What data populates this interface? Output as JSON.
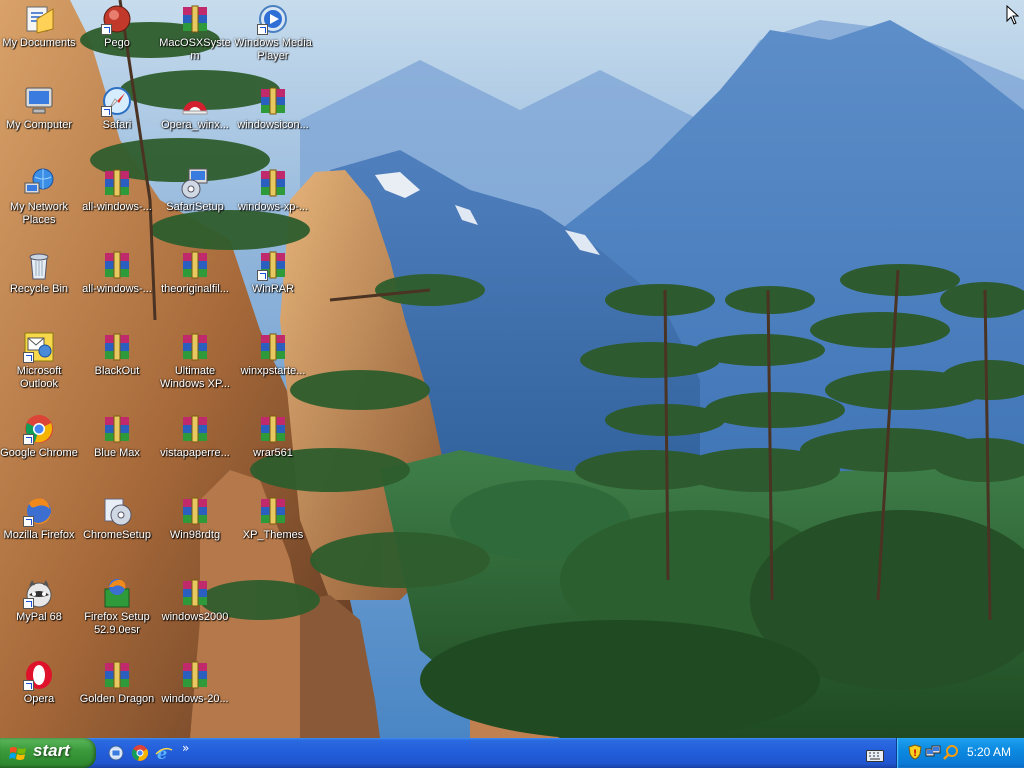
{
  "desktop": {
    "icons": [
      {
        "label": "My Documents"
      },
      {
        "label": "Pego"
      },
      {
        "label": "MacOSXSystem"
      },
      {
        "label": "Windows Media Player"
      },
      {
        "label": "My Computer"
      },
      {
        "label": "Safari"
      },
      {
        "label": "Opera_winx..."
      },
      {
        "label": "windowsicon..."
      },
      {
        "label": "My Network Places"
      },
      {
        "label": "all-windows-..."
      },
      {
        "label": "SafariSetup"
      },
      {
        "label": "windows-xp-..."
      },
      {
        "label": "Recycle Bin"
      },
      {
        "label": "all-windows-..."
      },
      {
        "label": "theoriginalfil..."
      },
      {
        "label": "WinRAR"
      },
      {
        "label": "Microsoft Outlook"
      },
      {
        "label": "BlackOut"
      },
      {
        "label": "Ultimate Windows XP..."
      },
      {
        "label": "winxpstarte..."
      },
      {
        "label": "Google Chrome"
      },
      {
        "label": "Blue Max"
      },
      {
        "label": "vistapaperre..."
      },
      {
        "label": "wrar561"
      },
      {
        "label": "Mozilla Firefox"
      },
      {
        "label": "ChromeSetup"
      },
      {
        "label": "Win98rdtg"
      },
      {
        "label": "XP_Themes"
      },
      {
        "label": "MyPal 68"
      },
      {
        "label": "Firefox Setup 52.9.0esr"
      },
      {
        "label": "windows2000"
      },
      {
        "label": "Opera"
      },
      {
        "label": "Golden Dragon"
      },
      {
        "label": "windows-20..."
      }
    ]
  },
  "taskbar": {
    "start_label": "start",
    "quick_launch": [
      "show-desktop-icon",
      "chrome-icon",
      "internet-explorer-icon"
    ],
    "tray_icons": [
      "security-shield-icon",
      "network-icon",
      "search-icon"
    ],
    "clock": "5:20 AM",
    "colors": {
      "taskbar": "#245edb",
      "start": "#3c9a3c",
      "tray": "#0c8ae0"
    }
  }
}
